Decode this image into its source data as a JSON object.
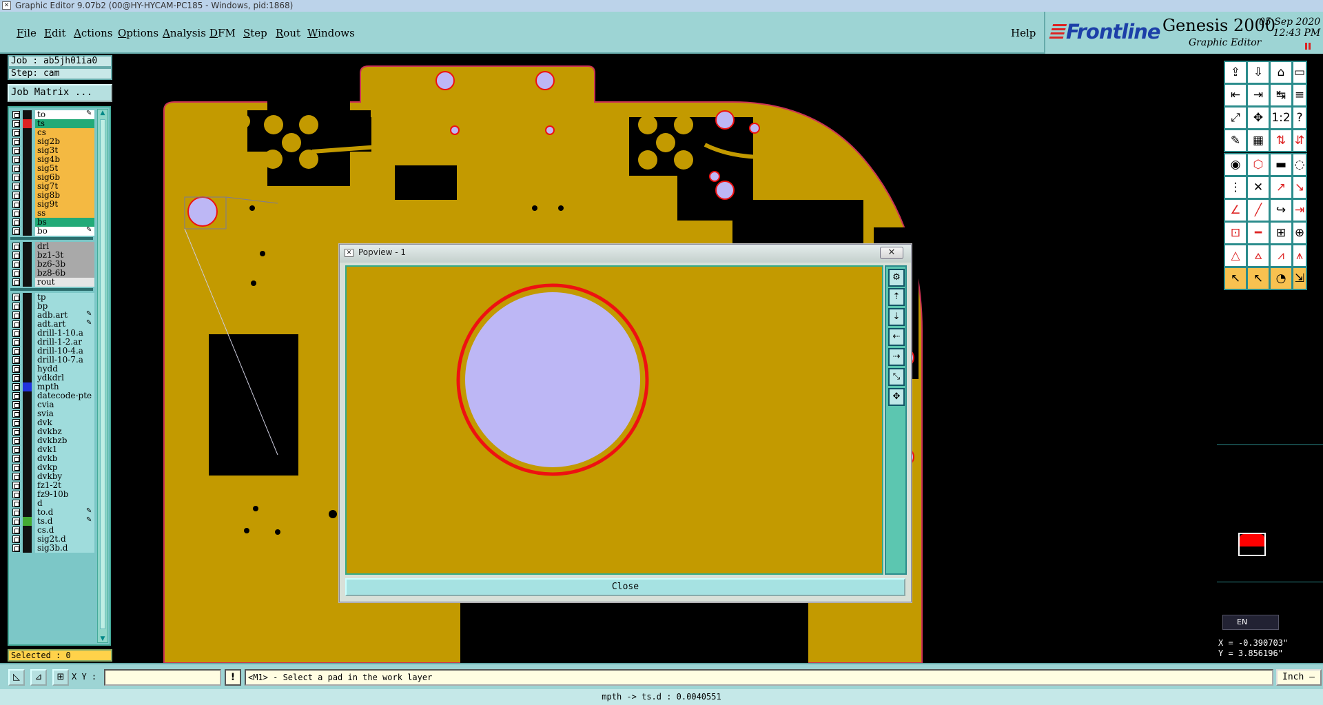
{
  "window": {
    "title": "Graphic Editor 9.07b2 (00@HY-HYCAM-PC185 - Windows, pid:1868)"
  },
  "menu": [
    {
      "label": "File",
      "u": "F",
      "rest": "ile"
    },
    {
      "label": "Edit",
      "u": "E",
      "rest": "dit"
    },
    {
      "label": "Actions",
      "u": "A",
      "rest": "ctions"
    },
    {
      "label": "Options",
      "u": "O",
      "rest": "ptions"
    },
    {
      "label": "Analysis",
      "u": "A",
      "rest": "nalysis"
    },
    {
      "label": "DFM",
      "u": "D",
      "rest": "FM"
    },
    {
      "label": "Step",
      "u": "S",
      "rest": "tep"
    },
    {
      "label": "Rout",
      "u": "R",
      "rest": "out"
    },
    {
      "label": "Windows",
      "u": "W",
      "rest": "indows"
    }
  ],
  "help_label": "Help",
  "logo": {
    "brand": "Frontline",
    "product": "Genesis 2000",
    "subtitle": "Graphic Editor",
    "date": "05 Sep 2020",
    "time": "12:43 PM"
  },
  "job": {
    "job_label": "Job : ab5jh01ia0",
    "step_label": "Step: cam",
    "matrix_button": "Job Matrix ..."
  },
  "layers": [
    {
      "name": "to",
      "color": "#ffffff",
      "swatch": "#111111",
      "mark": true
    },
    {
      "name": "ts",
      "color": "#22aa77",
      "swatch": "#dd2222"
    },
    {
      "name": "cs",
      "color": "#f4b942",
      "swatch": "#111111"
    },
    {
      "name": "sig2b",
      "color": "#f4b942",
      "swatch": "#111111"
    },
    {
      "name": "sig3t",
      "color": "#f4b942",
      "swatch": "#111111"
    },
    {
      "name": "sig4b",
      "color": "#f4b942",
      "swatch": "#111111"
    },
    {
      "name": "sig5t",
      "color": "#f4b942",
      "swatch": "#111111"
    },
    {
      "name": "sig6b",
      "color": "#f4b942",
      "swatch": "#111111"
    },
    {
      "name": "sig7t",
      "color": "#f4b942",
      "swatch": "#111111"
    },
    {
      "name": "sig8b",
      "color": "#f4b942",
      "swatch": "#111111"
    },
    {
      "name": "sig9t",
      "color": "#f4b942",
      "swatch": "#111111"
    },
    {
      "name": "ss",
      "color": "#f4b942",
      "swatch": "#111111"
    },
    {
      "name": "bs",
      "color": "#22aa77",
      "swatch": "#111111"
    },
    {
      "name": "bo",
      "color": "#ffffff",
      "swatch": "#111111",
      "mark": true
    },
    {
      "sep": true
    },
    {
      "name": "drl",
      "color": "#a9a9a9",
      "swatch": "#111111"
    },
    {
      "name": "bz1-3t",
      "color": "#a9a9a9",
      "swatch": "#111111"
    },
    {
      "name": "bz6-3b",
      "color": "#a9a9a9",
      "swatch": "#111111"
    },
    {
      "name": "bz8-6b",
      "color": "#a9a9a9",
      "swatch": "#111111"
    },
    {
      "name": "rout",
      "color": "#e6e6e6",
      "swatch": "#111111"
    },
    {
      "sep": true
    },
    {
      "name": "tp",
      "color": "#9fdcdc",
      "swatch": "#111111"
    },
    {
      "name": "bp",
      "color": "#9fdcdc",
      "swatch": "#111111"
    },
    {
      "name": "adb.art",
      "color": "#9fdcdc",
      "swatch": "#111111",
      "mark": true
    },
    {
      "name": "adt.art",
      "color": "#9fdcdc",
      "swatch": "#111111",
      "mark": true
    },
    {
      "name": "drill-1-10.a",
      "color": "#9fdcdc",
      "swatch": "#111111"
    },
    {
      "name": "drill-1-2.ar",
      "color": "#9fdcdc",
      "swatch": "#111111"
    },
    {
      "name": "drill-10-4.a",
      "color": "#9fdcdc",
      "swatch": "#111111"
    },
    {
      "name": "drill-10-7.a",
      "color": "#9fdcdc",
      "swatch": "#111111"
    },
    {
      "name": "hydd",
      "color": "#9fdcdc",
      "swatch": "#111111"
    },
    {
      "name": "ydkdrl",
      "color": "#9fdcdc",
      "swatch": "#111111"
    },
    {
      "name": "mpth",
      "color": "#9fdcdc",
      "swatch": "#2233dd"
    },
    {
      "name": "datecode-pte",
      "color": "#9fdcdc",
      "swatch": "#111111"
    },
    {
      "name": "cvia",
      "color": "#9fdcdc",
      "swatch": "#111111"
    },
    {
      "name": "svia",
      "color": "#9fdcdc",
      "swatch": "#111111"
    },
    {
      "name": "dvk",
      "color": "#9fdcdc",
      "swatch": "#111111"
    },
    {
      "name": "dvkbz",
      "color": "#9fdcdc",
      "swatch": "#111111"
    },
    {
      "name": "dvkbzb",
      "color": "#9fdcdc",
      "swatch": "#111111"
    },
    {
      "name": "dvk1",
      "color": "#9fdcdc",
      "swatch": "#111111"
    },
    {
      "name": "dvkb",
      "color": "#9fdcdc",
      "swatch": "#111111"
    },
    {
      "name": "dvkp",
      "color": "#9fdcdc",
      "swatch": "#111111"
    },
    {
      "name": "dvkby",
      "color": "#9fdcdc",
      "swatch": "#111111"
    },
    {
      "name": "fz1-2t",
      "color": "#9fdcdc",
      "swatch": "#111111"
    },
    {
      "name": "fz9-10b",
      "color": "#9fdcdc",
      "swatch": "#111111"
    },
    {
      "name": "d",
      "color": "#9fdcdc",
      "swatch": "#111111"
    },
    {
      "name": "to.d",
      "color": "#9fdcdc",
      "swatch": "#111111",
      "mark": true
    },
    {
      "name": "ts.d",
      "color": "#9fdcdc",
      "swatch": "#44aa33",
      "mark": true
    },
    {
      "name": "cs.d",
      "color": "#9fdcdc",
      "swatch": "#111111"
    },
    {
      "name": "sig2t.d",
      "color": "#9fdcdc",
      "swatch": "#111111"
    },
    {
      "name": "sig3b.d",
      "color": "#9fdcdc",
      "swatch": "#111111"
    }
  ],
  "selected_label": "Selected : 0",
  "popup": {
    "title": "Popview - 1",
    "close_x": "✕",
    "close_button": "Close"
  },
  "coords": {
    "x": "X = -0.390703\"",
    "y": "Y = 3.856196\""
  },
  "lang": "EN",
  "status": {
    "xy_label": "X Y :",
    "xy_value": "",
    "message": "<M1> - Select a pad in the work layer",
    "units": "Inch —"
  },
  "info": "mpth -> ts.d : 0.0040551",
  "colors": {
    "copper": "#c39a00",
    "pad": "#bdb7f5",
    "ring": "#ee1111",
    "outline": "#cc3355"
  }
}
